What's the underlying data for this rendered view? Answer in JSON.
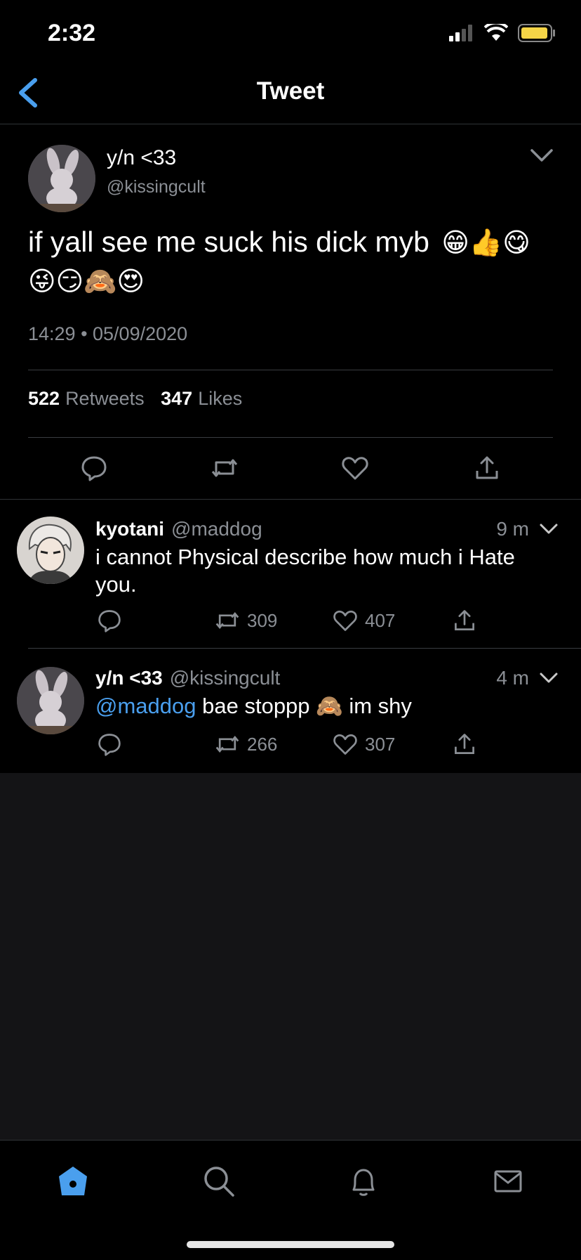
{
  "status_bar": {
    "time": "2:32"
  },
  "nav": {
    "title": "Tweet"
  },
  "main_tweet": {
    "name": "y/n <33",
    "handle": "@kissingcult",
    "text": "if yall see me suck his dick myb",
    "emojis_line1": "😁👍😋",
    "emojis_line2": "😜😏🙈😍",
    "timestamp": "14:29 • 05/09/2020",
    "retweets_count": "522",
    "retweets_label": "Retweets",
    "likes_count": "347",
    "likes_label": "Likes"
  },
  "replies": [
    {
      "name": "kyotani",
      "handle": "@maddog",
      "time": "9 m",
      "text": "i cannot Physical describe how much i Hate you.",
      "retweets": "309",
      "likes": "407"
    },
    {
      "name": "y/n <33",
      "handle": "@kissingcult",
      "time": "4 m",
      "mention": "@maddog",
      "text": "bae stoppp 🙈 im shy",
      "retweets": "266",
      "likes": "307"
    }
  ],
  "colors": {
    "accent": "#4a9fee",
    "secondary_text": "#8b8f95",
    "battery": "#f5d547"
  },
  "icons": [
    "back-chevron-icon",
    "reply-icon",
    "retweet-icon",
    "like-icon",
    "share-icon",
    "home-icon",
    "search-icon",
    "notifications-icon",
    "messages-icon"
  ]
}
